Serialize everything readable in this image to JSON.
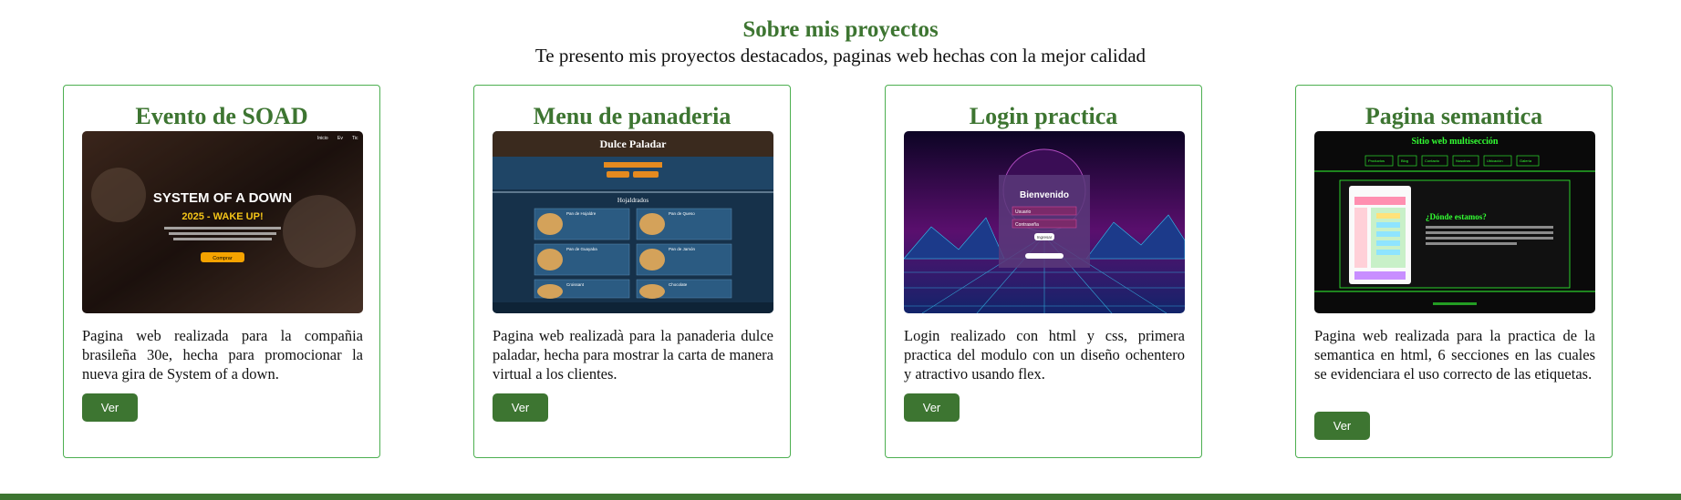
{
  "section": {
    "title": "Sobre mis proyectos",
    "subtitle": "Te presento mis proyectos destacados, paginas web hechas con la mejor calidad"
  },
  "cards": [
    {
      "title": "Evento de SOAD",
      "description": "Pagina web realizada para la compañia brasileña 30e, hecha para promocionar la nueva gira de System of a down.",
      "button": "Ver",
      "thumb": {
        "nav": [
          "Inicio",
          "Ev",
          "Tic"
        ],
        "heading": "SYSTEM OF A DOWN",
        "subheading": "2025 - WAKE UP!",
        "cta": "Comprar"
      }
    },
    {
      "title": "Menu de panaderia",
      "description": "Pagina web realizadà para la panaderia dulce paladar, hecha para mostrar la carta de manera virtual a los clientes.",
      "button": "Ver",
      "thumb": {
        "brand": "Dulce Paladar",
        "section": "Hojaldrados",
        "items": [
          "Pan de Hojaldre",
          "Pan de Queso",
          "Pan de Guayaba",
          "Pan de Jamón",
          "Croissant",
          "Chocolate"
        ]
      }
    },
    {
      "title": "Login practica",
      "description": "Login realizado con html y css, primera practica del modulo con un diseño ochentero y atractivo usando flex.",
      "button": "Ver",
      "thumb": {
        "heading": "Bienvenido",
        "user": "Usuario",
        "pass": "Contraseña",
        "enter": "Ingresar"
      }
    },
    {
      "title": "Pagina semantica",
      "description": "Pagina web realizada para la practica de la semantica en html, 6 secciones en las cuales se evidenciara el uso correcto de las etiquetas.",
      "button": "Ver",
      "thumb": {
        "heading": "Sitio web multisección",
        "nav": [
          "Productos",
          "Blog",
          "Contacto",
          "Nosotros",
          "Ubicación",
          "Galería"
        ],
        "subheading": "¿Dónde estamos?"
      }
    }
  ],
  "colors": {
    "accent": "#3d7531",
    "border": "#4caf50"
  }
}
